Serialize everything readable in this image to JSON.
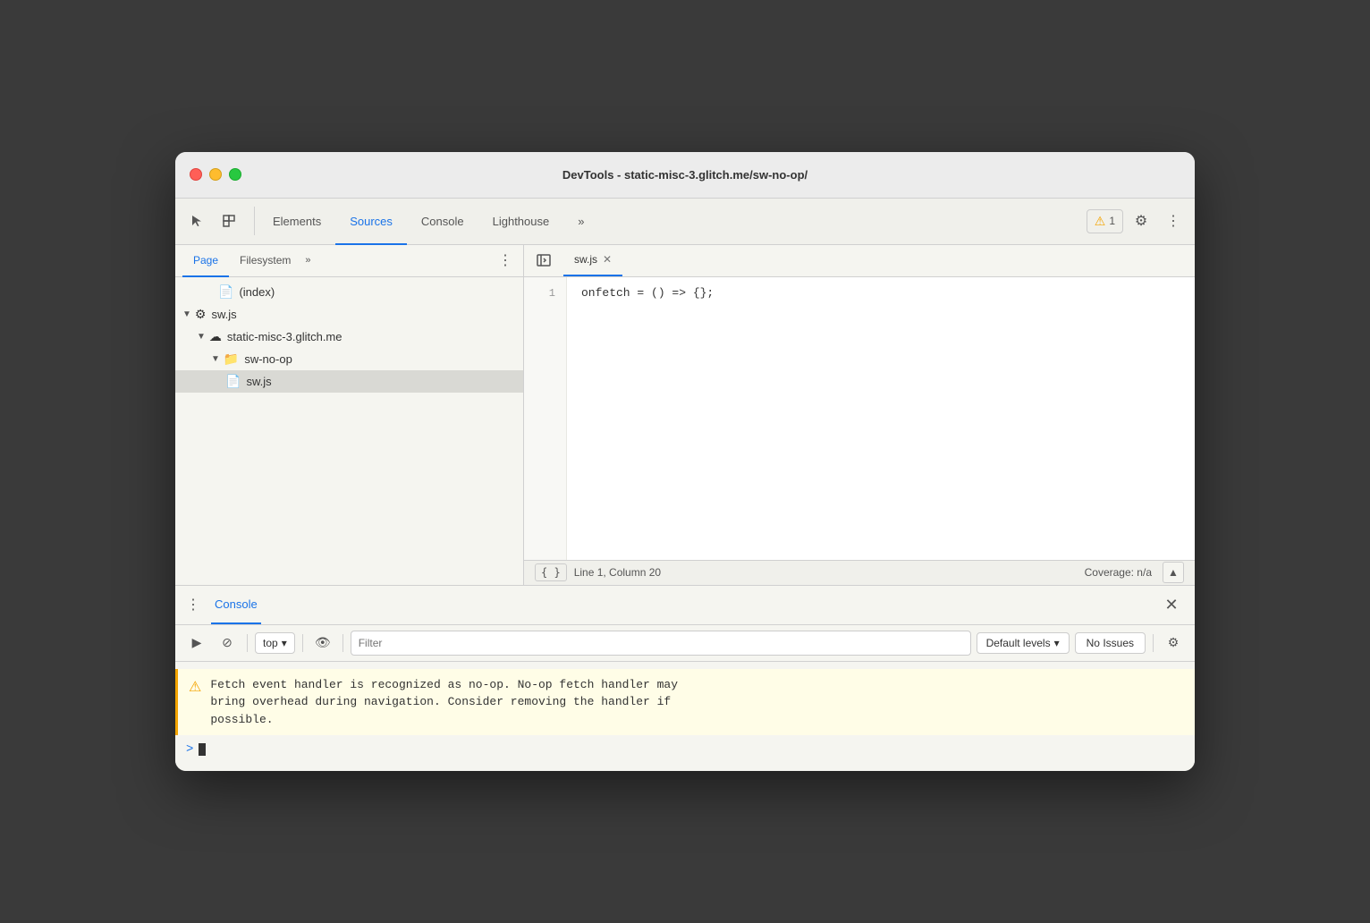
{
  "window": {
    "title": "DevTools - static-misc-3.glitch.me/sw-no-op/"
  },
  "devtools_toolbar": {
    "tabs": [
      {
        "label": "Elements",
        "active": false
      },
      {
        "label": "Sources",
        "active": true
      },
      {
        "label": "Console",
        "active": false
      },
      {
        "label": "Lighthouse",
        "active": false
      },
      {
        "label": "»",
        "active": false
      }
    ],
    "warning_count": "1",
    "gear_label": "⚙",
    "dots_label": "⋮"
  },
  "left_panel": {
    "tabs": [
      {
        "label": "Page",
        "active": true
      },
      {
        "label": "Filesystem",
        "active": false
      },
      {
        "label": "»",
        "active": false
      }
    ],
    "tree": [
      {
        "indent": 3,
        "icon": "📄",
        "label": "(index)",
        "arrow": "",
        "selected": false
      },
      {
        "indent": 1,
        "icon": "⚙",
        "label": "sw.js",
        "arrow": "▼",
        "selected": false
      },
      {
        "indent": 2,
        "icon": "☁",
        "label": "static-misc-3.glitch.me",
        "arrow": "▼",
        "selected": false
      },
      {
        "indent": 3,
        "icon": "📁",
        "label": "sw-no-op",
        "arrow": "▼",
        "folder": true,
        "selected": false
      },
      {
        "indent": 4,
        "icon": "📄",
        "label": "sw.js",
        "arrow": "",
        "selected": true,
        "yellow": true
      }
    ]
  },
  "editor": {
    "file_tab": "sw.js",
    "code_lines": [
      {
        "number": "1",
        "code": "onfetch = () => {};"
      }
    ]
  },
  "status_bar": {
    "format_btn": "{ }",
    "position": "Line 1, Column 20",
    "coverage": "Coverage: n/a"
  },
  "console_panel": {
    "title": "Console",
    "toolbar": {
      "top_label": "top",
      "filter_placeholder": "Filter",
      "default_levels": "Default levels",
      "no_issues": "No Issues"
    },
    "warning": {
      "text": "Fetch event handler is recognized as no-op. No-op fetch handler may\nbring overhead during navigation. Consider removing the handler if\npossible."
    },
    "prompt": ">"
  },
  "icons": {
    "cursor": "↖",
    "inspect": "⬜",
    "close": "✕",
    "play": "▶",
    "block": "⊘",
    "eye": "👁",
    "chevron_down": "▾",
    "up_arrow": "▲",
    "dots": "⋮",
    "gear": "⚙"
  }
}
